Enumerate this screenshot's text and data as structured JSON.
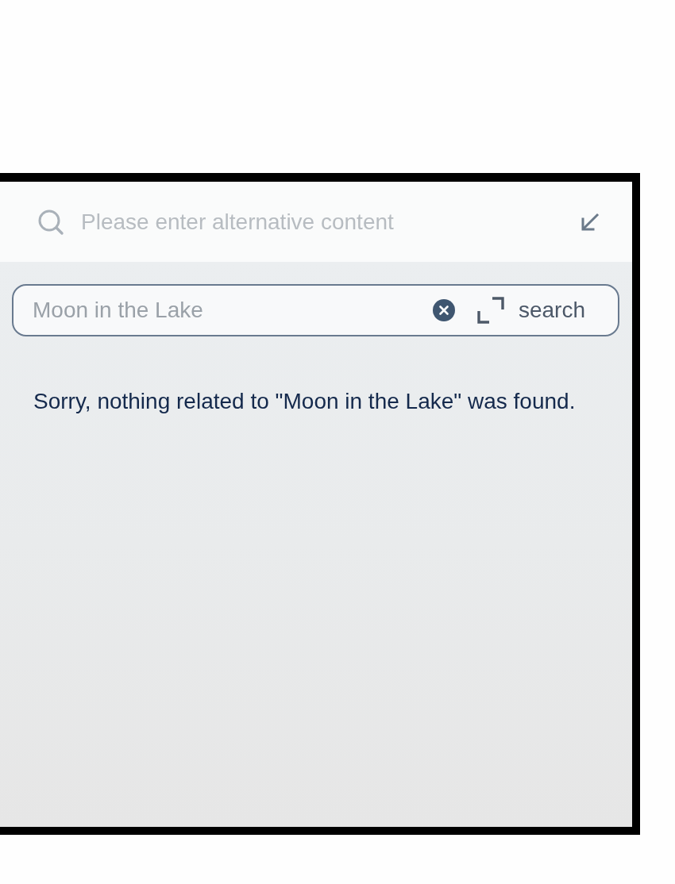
{
  "top_bar": {
    "placeholder": "Please enter alternative content"
  },
  "search_bar": {
    "value": "Moon in the Lake",
    "button": "search"
  },
  "message": "Sorry, nothing related to \"Moon in the Lake\" was found."
}
